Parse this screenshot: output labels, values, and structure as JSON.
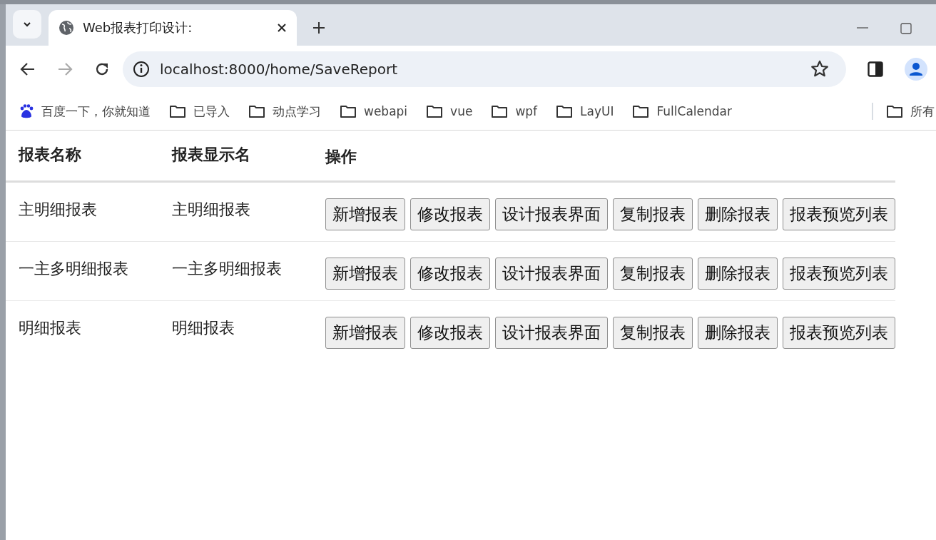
{
  "browser": {
    "tab": {
      "title": "Web报表打印设计:",
      "selected": true
    },
    "address": "localhost:8000/home/SaveReport",
    "bookmarks": [
      {
        "kind": "site",
        "label": "百度一下，你就知道"
      },
      {
        "kind": "folder",
        "label": "已导入"
      },
      {
        "kind": "folder",
        "label": "动点学习"
      },
      {
        "kind": "folder",
        "label": "webapi"
      },
      {
        "kind": "folder",
        "label": "vue"
      },
      {
        "kind": "folder",
        "label": "wpf"
      },
      {
        "kind": "folder",
        "label": "LayUI"
      },
      {
        "kind": "folder",
        "label": "FullCalendar"
      }
    ],
    "other_bookmarks": {
      "label": "所有"
    }
  },
  "table": {
    "columns": [
      "报表名称",
      "报表显示名",
      "操作"
    ],
    "rows": [
      {
        "name": "主明细报表",
        "display_name": "主明细报表",
        "actions": [
          "新增报表",
          "修改报表",
          "设计报表界面",
          "复制报表",
          "删除报表",
          "报表预览列表"
        ]
      },
      {
        "name": "一主多明细报表",
        "display_name": "一主多明细报表",
        "actions": [
          "新增报表",
          "修改报表",
          "设计报表界面",
          "复制报表",
          "删除报表",
          "报表预览列表"
        ]
      },
      {
        "name": "明细报表",
        "display_name": "明细报表",
        "actions": [
          "新增报表",
          "修改报表",
          "设计报表界面",
          "复制报表",
          "删除报表",
          "报表预览列表"
        ]
      }
    ]
  }
}
